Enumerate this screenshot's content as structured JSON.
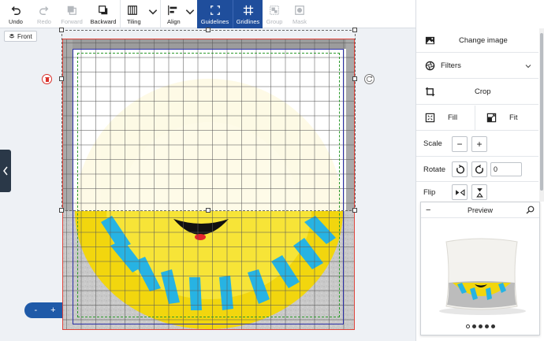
{
  "toolbar": {
    "undo": "Undo",
    "redo": "Redo",
    "forward": "Forward",
    "backward": "Backward",
    "tiling": "Tiling",
    "align": "Align",
    "guidelines": "Guidelines",
    "gridlines": "Gridlines",
    "group": "Group",
    "mask": "Mask"
  },
  "canvas": {
    "side_label": "Front",
    "zoom_minus": "-",
    "zoom_plus": "+"
  },
  "panel": {
    "change_image": "Change image",
    "filters": "Filters",
    "crop": "Crop",
    "fill": "Fill",
    "fit": "Fit",
    "scale": "Scale",
    "scale_minus": "−",
    "scale_plus": "+",
    "rotate": "Rotate",
    "rotate_value": "0",
    "flip": "Flip"
  },
  "preview": {
    "title": "Preview",
    "collapse": "−",
    "active_dot": 0,
    "dot_count": 5
  },
  "colors": {
    "accent": "#1f4e9c",
    "print_area_border": "#e0443a",
    "bleed_guide": "#2b2fa8",
    "safe_guide": "#2c9a2c"
  }
}
